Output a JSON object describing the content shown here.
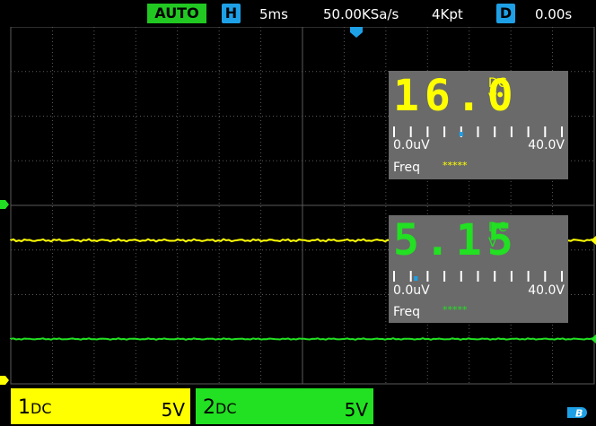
{
  "status_bar": {
    "trigger_mode": "AUTO",
    "horizontal_key": "H",
    "timebase": "5ms",
    "sample_rate": "50.00KSa/s",
    "memory_depth": "4Kpt",
    "delay_key": "D",
    "delay": "0.00s"
  },
  "meter1": {
    "value": "16.0",
    "coupling": "DC",
    "unit": "V",
    "range_low": "0.0uV",
    "range_high": "40.0V",
    "freq_label": "Freq",
    "freq_value": "*****",
    "bar_fraction": 0.4
  },
  "meter2": {
    "value": "5.15",
    "coupling": "DC",
    "unit": "V",
    "range_low": "0.0uV",
    "range_high": "40.0V",
    "freq_label": "Freq",
    "freq_value": "*****",
    "bar_fraction": 0.13
  },
  "channels": [
    {
      "name": "1",
      "coupling": "DC",
      "scale": "5V",
      "color": "#ffff00"
    },
    {
      "name": "2",
      "coupling": "DC",
      "scale": "5V",
      "color": "#22e022"
    }
  ],
  "usb_icon": {
    "label": "B"
  },
  "colors": {
    "grid": "#5a5a5a",
    "ch1": "#ffff00",
    "ch2": "#22e022",
    "marker": "#1ea0e6"
  }
}
